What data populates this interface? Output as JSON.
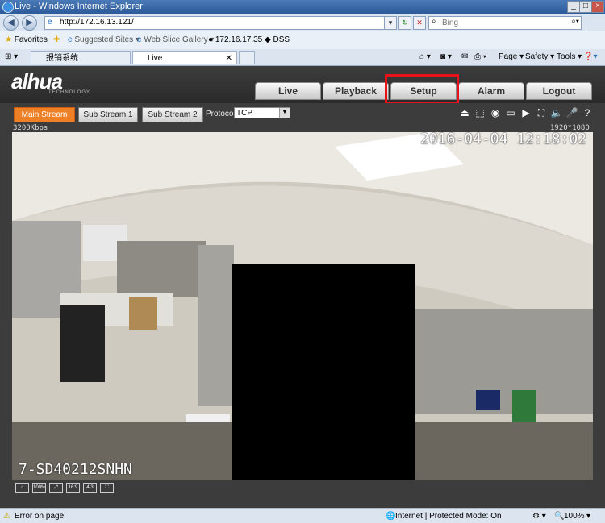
{
  "window": {
    "title": "Live - Windows Internet Explorer",
    "min": "_",
    "max": "□",
    "close": "×"
  },
  "address": {
    "url": "http://172.16.13.121/",
    "search_placeholder": "Bing"
  },
  "favorites": {
    "label": "Favorites",
    "items": [
      "Suggested Sites ▾",
      "Web Slice Gallery ▾",
      "172.16.17.35",
      "DSS"
    ]
  },
  "tabs": [
    {
      "label": "报销系统"
    },
    {
      "label": "Live"
    }
  ],
  "commands": {
    "page": "Page ▾",
    "safety": "Safety ▾",
    "tools": "Tools ▾"
  },
  "app": {
    "logo": "alhua",
    "logo_sub": "TECHNOLOGY",
    "nav": [
      "Live",
      "Playback",
      "Setup",
      "Alarm",
      "Logout"
    ],
    "streams": [
      "Main Stream",
      "Sub Stream 1",
      "Sub Stream 2"
    ],
    "active_stream": "Main Stream",
    "protocol_label": "Protocol",
    "protocol_value": "TCP",
    "bitrate": "3200Kbps",
    "resolution": "1920*1080",
    "osd_time": "2016-04-04 12:18:02",
    "osd_name": "7-SD40212SNHN",
    "bottom_buttons": [
      "100%",
      "⤢",
      "16:9",
      "4:3",
      "⛶"
    ]
  },
  "status": {
    "left": "Error on page.",
    "zone": "Internet | Protected Mode: On",
    "zoom": "100%"
  }
}
